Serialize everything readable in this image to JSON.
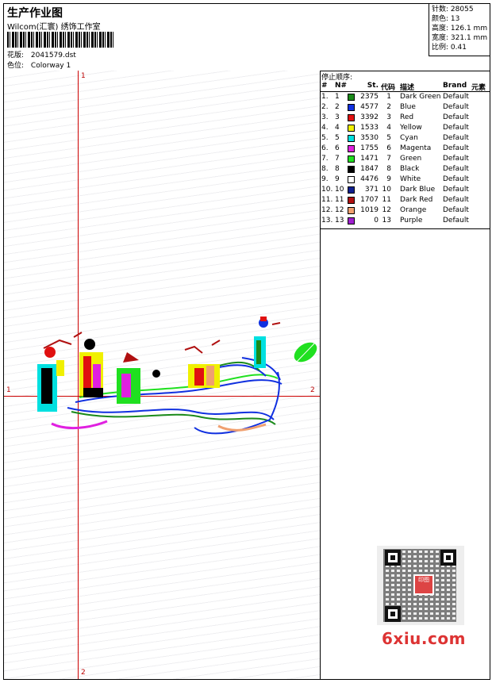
{
  "header": {
    "title": "生产作业图",
    "company": "Wilcom(汇寰) 绣饰工作室",
    "design_label": "花版:",
    "design_value": "2041579.dst",
    "colorway_label": "色位:",
    "colorway_value": "Colorway 1"
  },
  "stats": [
    {
      "label": "针数:",
      "value": "28055"
    },
    {
      "label": "颜色:",
      "value": "13"
    },
    {
      "label": "高度:",
      "value": "126.1 mm"
    },
    {
      "label": "宽度:",
      "value": "321.1 mm"
    },
    {
      "label": "比例:",
      "value": "0.41"
    }
  ],
  "canvas": {
    "axis_v_top": "1",
    "axis_v_bottom": "2",
    "axis_h_left": "1",
    "axis_h_right": "2"
  },
  "stop_table": {
    "title": "停止顺序:",
    "headers": [
      "#",
      "N#",
      "St.",
      "代码",
      "描述",
      "Brand",
      "元素"
    ],
    "rows": [
      {
        "num": "1.",
        "n": "1",
        "st": "2375",
        "code": "1",
        "desc": "Dark Green",
        "brand": "Default",
        "color": "#1a8a1a"
      },
      {
        "num": "2.",
        "n": "2",
        "st": "4577",
        "code": "2",
        "desc": "Blue",
        "brand": "Default",
        "color": "#1030e0"
      },
      {
        "num": "3.",
        "n": "3",
        "st": "3392",
        "code": "3",
        "desc": "Red",
        "brand": "Default",
        "color": "#e01010"
      },
      {
        "num": "4.",
        "n": "4",
        "st": "1533",
        "code": "4",
        "desc": "Yellow",
        "brand": "Default",
        "color": "#f0f000"
      },
      {
        "num": "5.",
        "n": "5",
        "st": "3530",
        "code": "5",
        "desc": "Cyan",
        "brand": "Default",
        "color": "#00e0e0"
      },
      {
        "num": "6.",
        "n": "6",
        "st": "1755",
        "code": "6",
        "desc": "Magenta",
        "brand": "Default",
        "color": "#e020e0"
      },
      {
        "num": "7.",
        "n": "7",
        "st": "1471",
        "code": "7",
        "desc": "Green",
        "brand": "Default",
        "color": "#20e020"
      },
      {
        "num": "8.",
        "n": "8",
        "st": "1847",
        "code": "8",
        "desc": "Black",
        "brand": "Default",
        "color": "#000000"
      },
      {
        "num": "9.",
        "n": "9",
        "st": "4476",
        "code": "9",
        "desc": "White",
        "brand": "Default",
        "color": "#ffffff"
      },
      {
        "num": "10.",
        "n": "10",
        "st": "371",
        "code": "10",
        "desc": "Dark Blue",
        "brand": "Default",
        "color": "#102090"
      },
      {
        "num": "11.",
        "n": "11",
        "st": "1707",
        "code": "11",
        "desc": "Dark Red",
        "brand": "Default",
        "color": "#b01010"
      },
      {
        "num": "12.",
        "n": "12",
        "st": "1019",
        "code": "12",
        "desc": "Orange",
        "brand": "Default",
        "color": "#f0a070"
      },
      {
        "num": "13.",
        "n": "13",
        "st": "0",
        "code": "13",
        "desc": "Purple",
        "brand": "Default",
        "color": "#a020d0"
      }
    ]
  },
  "watermark": {
    "site": "6xiu.com",
    "seal": "印图"
  }
}
